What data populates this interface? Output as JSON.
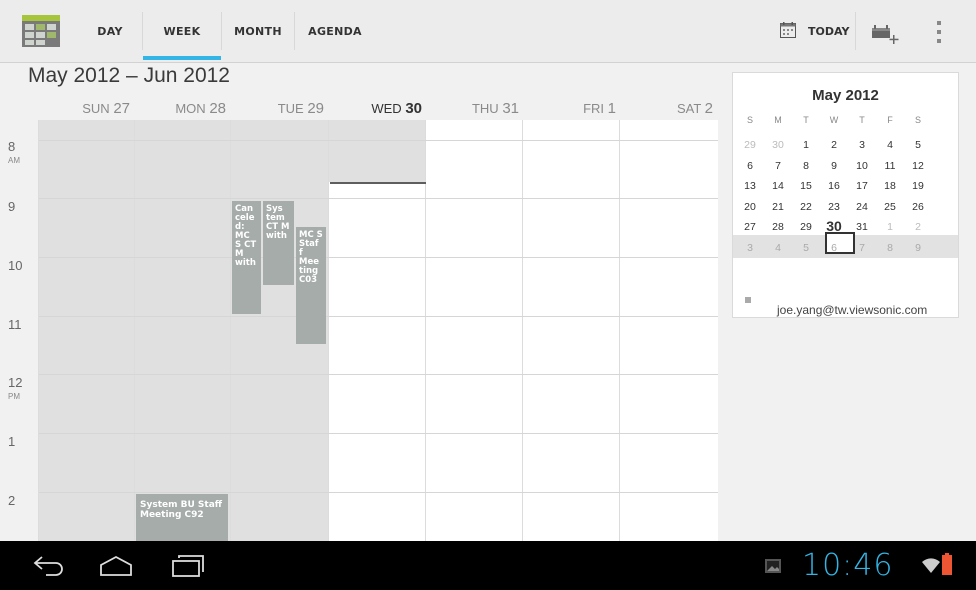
{
  "app": {
    "tabs": [
      {
        "label": "DAY",
        "selected": false
      },
      {
        "label": "WEEK",
        "selected": true
      },
      {
        "label": "MONTH",
        "selected": false
      },
      {
        "label": "AGENDA",
        "selected": false
      }
    ],
    "today_label": "TODAY",
    "icons": [
      "calendar-app-icon",
      "today-calendar-icon",
      "new-event-icon",
      "overflow-menu-icon"
    ]
  },
  "week": {
    "range_title": "May 2012 – Jun 2012",
    "days": [
      {
        "dow": "SUN",
        "num": "27",
        "today": false
      },
      {
        "dow": "MON",
        "num": "28",
        "today": false
      },
      {
        "dow": "TUE",
        "num": "29",
        "today": false
      },
      {
        "dow": "WED",
        "num": "30",
        "today": true
      },
      {
        "dow": "THU",
        "num": "31",
        "today": false
      },
      {
        "dow": "FRI",
        "num": "1",
        "today": false
      },
      {
        "dow": "SAT",
        "num": "2",
        "today": false
      }
    ],
    "hours": [
      {
        "label": "8",
        "ampm": "AM"
      },
      {
        "label": "9",
        "ampm": ""
      },
      {
        "label": "10",
        "ampm": ""
      },
      {
        "label": "11",
        "ampm": ""
      },
      {
        "label": "12",
        "ampm": "PM"
      },
      {
        "label": "1",
        "ampm": ""
      },
      {
        "label": "2",
        "ampm": ""
      }
    ],
    "events": [
      {
        "title": "Can cele d: MC S CT M with"
      },
      {
        "title": "Sys tem CT M with"
      },
      {
        "title": "MC S Staf f Mee ting C03"
      },
      {
        "title": "System BU Staff Meeting C92"
      }
    ]
  },
  "mini_month": {
    "title": "May 2012",
    "dow": [
      "S",
      "M",
      "T",
      "W",
      "T",
      "F",
      "S"
    ],
    "weeks": [
      [
        "29",
        "30",
        "1",
        "2",
        "3",
        "4",
        "5"
      ],
      [
        "6",
        "7",
        "8",
        "9",
        "10",
        "11",
        "12"
      ],
      [
        "13",
        "14",
        "15",
        "16",
        "17",
        "18",
        "19"
      ],
      [
        "20",
        "21",
        "22",
        "23",
        "24",
        "25",
        "26"
      ],
      [
        "27",
        "28",
        "29",
        "30",
        "31",
        "1",
        "2"
      ],
      [
        "3",
        "4",
        "5",
        "6",
        "7",
        "8",
        "9"
      ]
    ],
    "calendar_name": "joe.yang@tw.viewsonic.com"
  },
  "navbar": {
    "clock": "10:46",
    "icons": [
      "back-icon",
      "home-icon",
      "recent-apps-icon",
      "gallery-notification-icon",
      "wifi-icon",
      "battery-icon"
    ]
  },
  "colors": {
    "accent": "#33b5e5",
    "event": "#a5acaa",
    "past_day": "#e0e0e0"
  }
}
